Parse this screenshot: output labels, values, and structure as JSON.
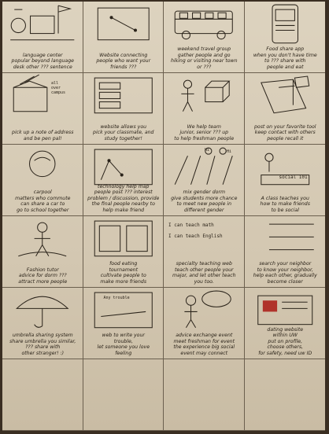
{
  "cells": [
    {
      "caption": "language center\npopular beyond language\ndesk other ??? sentence"
    },
    {
      "caption": "Website connecting\npeople who want your\nfriends ???"
    },
    {
      "caption": "weekend travel group\ngather people and go\nhiking or visiting near town\nor ???"
    },
    {
      "caption": "Food share app\nwhen you don't have time\nto ??? share with\npeople and eat"
    },
    {
      "caption": "pick up a note of address\nand be pen pal!",
      "notes": [
        "all\nover\ncampus"
      ]
    },
    {
      "caption": "website allows you\npick your classmate, and\nstudy together!",
      "notes": [
        "???",
        "???",
        "???"
      ]
    },
    {
      "caption": "We help team\njunior, senior ??? up\nto help freshman people"
    },
    {
      "caption": "post on your favorite tool\nkeep contact with others\npeople recall it"
    },
    {
      "caption": "carpool\nmatters who commute\ncan share a car to\ngo to school together"
    },
    {
      "caption": "technology help map\npeople post ??? interest\nproblem / discussion, provide\nthe final people nearby to\nhelp make friend"
    },
    {
      "caption": "mix gender dorm\ngive students more chance\nto meet new people in\ndifferent gender",
      "notes": [
        "Hi",
        "Hi"
      ]
    },
    {
      "caption": "A class teaches you\nhow to make friends\nto be social",
      "notes": [
        "social 101"
      ]
    },
    {
      "caption": "Fashion tutor\nadvice for dorm ???\nattract more people"
    },
    {
      "caption": "food eating\ntournament\ncultivate people to\nmake more friends"
    },
    {
      "caption": "specialty teaching web\nteach other people your\nmajor, and let other teach\nyou too.",
      "notes": [
        "I can teach math",
        "I can teach English"
      ]
    },
    {
      "caption": "search your neighbor\nto know your neighbor,\nhelp each other, gradually\nbecome closer"
    },
    {
      "caption": "umbrella sharing system\nshare umbrella you similar,\n??? share with\nother stranger! :)"
    },
    {
      "caption": "web to write your\ntrouble,\nlet someone you love\nfeeling",
      "notes": [
        "Any trouble"
      ]
    },
    {
      "caption": "advice exchange event\nmeet freshman for event\nthe experience big social\nevent may connect"
    },
    {
      "caption": "dating website\nwithin UW\nput on profile,\nchoose others,\nfor safety, need uw ID"
    },
    {
      "caption": ""
    },
    {
      "caption": ""
    },
    {
      "caption": ""
    },
    {
      "caption": ""
    }
  ]
}
